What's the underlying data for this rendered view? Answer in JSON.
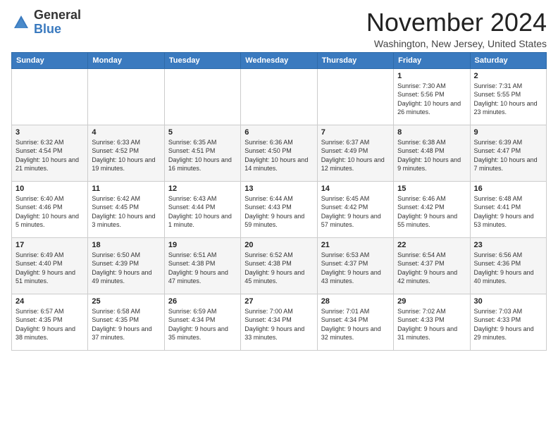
{
  "logo": {
    "general": "General",
    "blue": "Blue"
  },
  "title": "November 2024",
  "location": "Washington, New Jersey, United States",
  "weekdays": [
    "Sunday",
    "Monday",
    "Tuesday",
    "Wednesday",
    "Thursday",
    "Friday",
    "Saturday"
  ],
  "weeks": [
    [
      {
        "day": "",
        "info": ""
      },
      {
        "day": "",
        "info": ""
      },
      {
        "day": "",
        "info": ""
      },
      {
        "day": "",
        "info": ""
      },
      {
        "day": "",
        "info": ""
      },
      {
        "day": "1",
        "info": "Sunrise: 7:30 AM\nSunset: 5:56 PM\nDaylight: 10 hours and 26 minutes."
      },
      {
        "day": "2",
        "info": "Sunrise: 7:31 AM\nSunset: 5:55 PM\nDaylight: 10 hours and 23 minutes."
      }
    ],
    [
      {
        "day": "3",
        "info": "Sunrise: 6:32 AM\nSunset: 4:54 PM\nDaylight: 10 hours and 21 minutes."
      },
      {
        "day": "4",
        "info": "Sunrise: 6:33 AM\nSunset: 4:52 PM\nDaylight: 10 hours and 19 minutes."
      },
      {
        "day": "5",
        "info": "Sunrise: 6:35 AM\nSunset: 4:51 PM\nDaylight: 10 hours and 16 minutes."
      },
      {
        "day": "6",
        "info": "Sunrise: 6:36 AM\nSunset: 4:50 PM\nDaylight: 10 hours and 14 minutes."
      },
      {
        "day": "7",
        "info": "Sunrise: 6:37 AM\nSunset: 4:49 PM\nDaylight: 10 hours and 12 minutes."
      },
      {
        "day": "8",
        "info": "Sunrise: 6:38 AM\nSunset: 4:48 PM\nDaylight: 10 hours and 9 minutes."
      },
      {
        "day": "9",
        "info": "Sunrise: 6:39 AM\nSunset: 4:47 PM\nDaylight: 10 hours and 7 minutes."
      }
    ],
    [
      {
        "day": "10",
        "info": "Sunrise: 6:40 AM\nSunset: 4:46 PM\nDaylight: 10 hours and 5 minutes."
      },
      {
        "day": "11",
        "info": "Sunrise: 6:42 AM\nSunset: 4:45 PM\nDaylight: 10 hours and 3 minutes."
      },
      {
        "day": "12",
        "info": "Sunrise: 6:43 AM\nSunset: 4:44 PM\nDaylight: 10 hours and 1 minute."
      },
      {
        "day": "13",
        "info": "Sunrise: 6:44 AM\nSunset: 4:43 PM\nDaylight: 9 hours and 59 minutes."
      },
      {
        "day": "14",
        "info": "Sunrise: 6:45 AM\nSunset: 4:42 PM\nDaylight: 9 hours and 57 minutes."
      },
      {
        "day": "15",
        "info": "Sunrise: 6:46 AM\nSunset: 4:42 PM\nDaylight: 9 hours and 55 minutes."
      },
      {
        "day": "16",
        "info": "Sunrise: 6:48 AM\nSunset: 4:41 PM\nDaylight: 9 hours and 53 minutes."
      }
    ],
    [
      {
        "day": "17",
        "info": "Sunrise: 6:49 AM\nSunset: 4:40 PM\nDaylight: 9 hours and 51 minutes."
      },
      {
        "day": "18",
        "info": "Sunrise: 6:50 AM\nSunset: 4:39 PM\nDaylight: 9 hours and 49 minutes."
      },
      {
        "day": "19",
        "info": "Sunrise: 6:51 AM\nSunset: 4:38 PM\nDaylight: 9 hours and 47 minutes."
      },
      {
        "day": "20",
        "info": "Sunrise: 6:52 AM\nSunset: 4:38 PM\nDaylight: 9 hours and 45 minutes."
      },
      {
        "day": "21",
        "info": "Sunrise: 6:53 AM\nSunset: 4:37 PM\nDaylight: 9 hours and 43 minutes."
      },
      {
        "day": "22",
        "info": "Sunrise: 6:54 AM\nSunset: 4:37 PM\nDaylight: 9 hours and 42 minutes."
      },
      {
        "day": "23",
        "info": "Sunrise: 6:56 AM\nSunset: 4:36 PM\nDaylight: 9 hours and 40 minutes."
      }
    ],
    [
      {
        "day": "24",
        "info": "Sunrise: 6:57 AM\nSunset: 4:35 PM\nDaylight: 9 hours and 38 minutes."
      },
      {
        "day": "25",
        "info": "Sunrise: 6:58 AM\nSunset: 4:35 PM\nDaylight: 9 hours and 37 minutes."
      },
      {
        "day": "26",
        "info": "Sunrise: 6:59 AM\nSunset: 4:34 PM\nDaylight: 9 hours and 35 minutes."
      },
      {
        "day": "27",
        "info": "Sunrise: 7:00 AM\nSunset: 4:34 PM\nDaylight: 9 hours and 33 minutes."
      },
      {
        "day": "28",
        "info": "Sunrise: 7:01 AM\nSunset: 4:34 PM\nDaylight: 9 hours and 32 minutes."
      },
      {
        "day": "29",
        "info": "Sunrise: 7:02 AM\nSunset: 4:33 PM\nDaylight: 9 hours and 31 minutes."
      },
      {
        "day": "30",
        "info": "Sunrise: 7:03 AM\nSunset: 4:33 PM\nDaylight: 9 hours and 29 minutes."
      }
    ]
  ]
}
